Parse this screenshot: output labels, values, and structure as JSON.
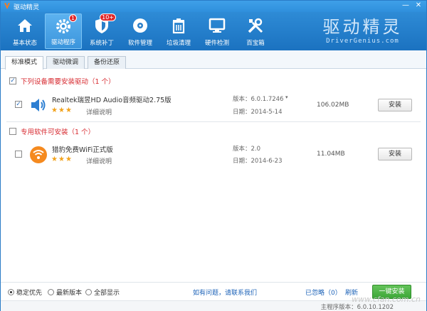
{
  "window": {
    "title": "驱动精灵",
    "minimize": "—",
    "close": "✕"
  },
  "toolbar": {
    "items": [
      {
        "label": "基本状态",
        "icon": "home-icon"
      },
      {
        "label": "驱动程序",
        "icon": "gear-icon",
        "badge": "1"
      },
      {
        "label": "系统补丁",
        "icon": "shield-icon",
        "badge": "10+"
      },
      {
        "label": "软件管理",
        "icon": "disc-icon"
      },
      {
        "label": "垃圾清理",
        "icon": "trash-icon"
      },
      {
        "label": "硬件检测",
        "icon": "monitor-icon"
      },
      {
        "label": "百宝箱",
        "icon": "tools-icon"
      }
    ],
    "brand_cn": "驱动精灵",
    "brand_en": "DriverGenius.com"
  },
  "tabs": [
    "标准模式",
    "驱动微调",
    "备份还原"
  ],
  "section1": {
    "title": "下列设备需要安装驱动（1 个）"
  },
  "driver": {
    "name": "Realtek瑞昱HD Audio音频驱动2.75版",
    "detail": "详细说明",
    "version": "版本：6.0.1.7246",
    "date": "日期：2014-5-14",
    "size": "106.02MB",
    "action": "安装",
    "stars": 3
  },
  "section2": {
    "title": "专用软件可安装（1 个）"
  },
  "software": {
    "name": "猎豹免费WiFi正式版",
    "detail": "详细说明",
    "version": "版本：2.0",
    "date": "日期：2014-6-23",
    "size": "11.04MB",
    "action": "安装",
    "stars": 3
  },
  "footer": {
    "radios": [
      "稳定优先",
      "最新版本",
      "全部显示"
    ],
    "help_link": "如有问题，请联系我们",
    "ignored": "已忽略（0）",
    "refresh": "刷新",
    "install_all": "一键安装"
  },
  "statusbar": {
    "version": "主程序版本：6.0.10.1202"
  },
  "watermark": "www.cfan.com.cn"
}
